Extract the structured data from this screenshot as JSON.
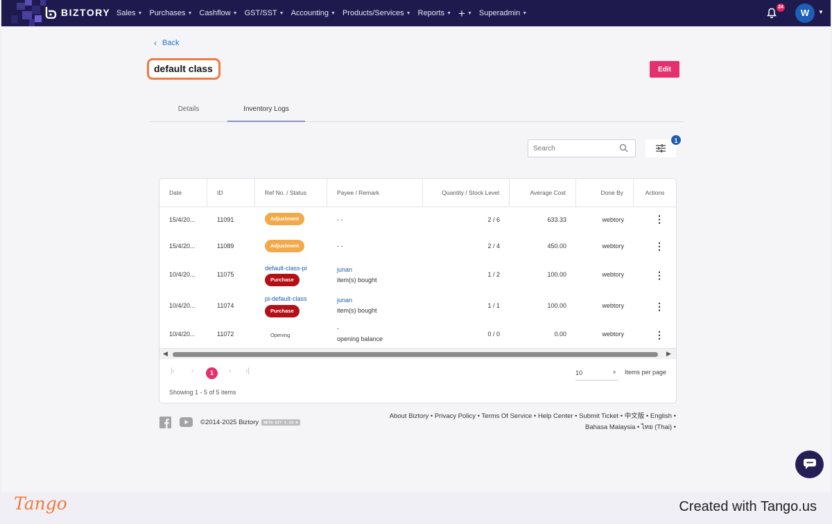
{
  "topbar": {
    "brand": "BIZTORY",
    "nav": [
      {
        "label": "Sales"
      },
      {
        "label": "Purchases"
      },
      {
        "label": "Cashflow"
      },
      {
        "label": "GST/SST"
      },
      {
        "label": "Accounting"
      },
      {
        "label": "Products/Services"
      },
      {
        "label": "Reports"
      },
      {
        "label": "+"
      },
      {
        "label": "Superadmin"
      }
    ],
    "notification_count": "24",
    "avatar_letter": "W",
    "brand_color": "#1f1a4d"
  },
  "page": {
    "back_label": "Back",
    "title": "default class",
    "edit_label": "Edit",
    "tabs": [
      {
        "label": "Details",
        "active": false
      },
      {
        "label": "Inventory Logs",
        "active": true
      }
    ],
    "search_placeholder": "Search",
    "filter_count": "1"
  },
  "table": {
    "columns": [
      "Date",
      "ID",
      "Ref No. / Status",
      "Payee / Remark",
      "Quantity / Stock Level",
      "Average Cost",
      "Done By",
      "Actions"
    ],
    "rows": [
      {
        "date": "15/4/20...",
        "id": "11091",
        "ref": "",
        "status": "Adjustment",
        "payee": "- -",
        "remark": "",
        "qty": "2 / 6",
        "cost": "633.33",
        "done_by": "webtory"
      },
      {
        "date": "15/4/20...",
        "id": "11089",
        "ref": "",
        "status": "Adjustment",
        "payee": "- -",
        "remark": "",
        "qty": "2 / 4",
        "cost": "450.00",
        "done_by": "webtory"
      },
      {
        "date": "10/4/20...",
        "id": "11075",
        "ref": "default-class-pi",
        "status": "Purchase",
        "payee": "junan",
        "remark": "item(s) bought",
        "qty": "1 / 2",
        "cost": "100.00",
        "done_by": "webtory"
      },
      {
        "date": "10/4/20...",
        "id": "11074",
        "ref": "pi-default-class",
        "status": "Purchase",
        "payee": "junan",
        "remark": "item(s) bought",
        "qty": "1 / 1",
        "cost": "100.00",
        "done_by": "webtory"
      },
      {
        "date": "10/4/20...",
        "id": "11072",
        "ref": "",
        "status": "Opening",
        "payee": "-",
        "remark": "opening balance",
        "qty": "0 / 0",
        "cost": "0.00",
        "done_by": "webtory"
      }
    ]
  },
  "pagination": {
    "current_page": "1",
    "per_page": "10",
    "per_page_label": "Items per page",
    "showing": "Showing 1 - 5 of 5 items"
  },
  "footer": {
    "copyright": "©2014-2025 Biztory",
    "version": "BETA-SIT 1.13.0",
    "links_line1": "About Biztory • Privacy Policy • Terms Of Service • Help Center • Submit Ticket • 中文版 • English •",
    "links_line2": "Bahasa Malaysia • ไทย (Thai) •"
  },
  "tango": {
    "logo": "Tango",
    "created": "Created with Tango.us"
  },
  "colors": {
    "accent": "#e4306c",
    "adjustment": "#f2a94a",
    "purchase": "#b30f16",
    "link": "#1e5eb6",
    "highlight": "#f07a3e"
  }
}
